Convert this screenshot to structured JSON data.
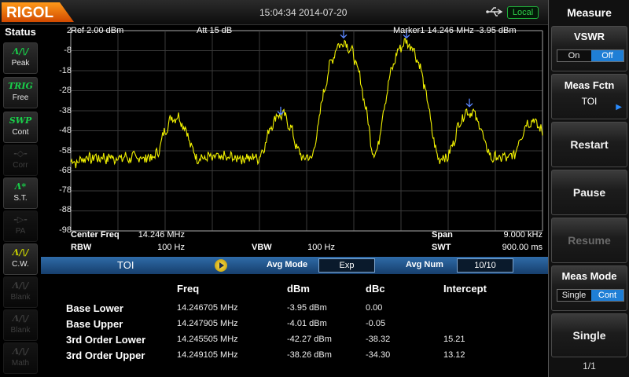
{
  "brand": "RIGOL",
  "datetime": "15:04:34 2014-07-20",
  "local_badge": "Local",
  "status": {
    "title": "Status",
    "items": [
      {
        "icon": "Λ/\\/",
        "label": "Peak",
        "state": "active"
      },
      {
        "icon": "TRIG",
        "label": "Free",
        "state": "active"
      },
      {
        "icon": "SWP",
        "label": "Cont",
        "state": "active"
      },
      {
        "icon": "-◇-",
        "label": "Corr",
        "state": "dim"
      },
      {
        "icon": "Λ*",
        "label": "S.T.",
        "state": "active"
      },
      {
        "icon": "-▷-",
        "label": "PA",
        "state": "dim"
      },
      {
        "icon": "Λ/\\/",
        "label": "C.W.",
        "state": "active"
      },
      {
        "icon": "Λ/\\/",
        "label": "Blank",
        "state": "dim"
      },
      {
        "icon": "Λ/\\/",
        "label": "Blank",
        "state": "dim"
      },
      {
        "icon": "Λ/\\/",
        "label": "Math",
        "state": "dim"
      }
    ]
  },
  "plot": {
    "ref_label": "Ref  2.00 dBm",
    "att_label": "Att      15 dB",
    "marker_label": "Marker1   14.246 MHz   -3.95 dBm",
    "y_ticks": [
      "2",
      "-8",
      "-18",
      "-28",
      "-38",
      "-48",
      "-58",
      "-68",
      "-78",
      "-88",
      "-98"
    ],
    "center_freq_label": "Center Freq",
    "center_freq_value": "14.246 MHz",
    "span_label": "Span",
    "span_value": "9.000 kHz",
    "rbw_label": "RBW",
    "rbw_value": "100 Hz",
    "vbw_label": "VBW",
    "vbw_value": "100 Hz",
    "swt_label": "SWT",
    "swt_value": "900.00 ms",
    "trace_color": "#f2f200",
    "marker_color": "#5b86ff",
    "grid_color": "#3a3a3a"
  },
  "chart_data": {
    "type": "line",
    "x_unit": "MHz",
    "y_unit": "dBm",
    "xlim": [
      14.2415,
      14.2505
    ],
    "ylim": [
      -98,
      2
    ],
    "series": [
      {
        "x": [
          14.2415,
          14.2425,
          14.2435,
          14.2445,
          14.2455,
          14.2467,
          14.2479,
          14.2491,
          14.2503,
          14.2505
        ],
        "y": [
          -64,
          -60,
          -41,
          -59,
          -40,
          -3.95,
          -4.01,
          -38.3,
          -43,
          -62
        ]
      }
    ],
    "markers": [
      {
        "x": 14.246705,
        "y": -3.95
      },
      {
        "x": 14.247905,
        "y": -4.01
      },
      {
        "x": 14.245505,
        "y": -42.27
      },
      {
        "x": 14.249105,
        "y": -38.26
      }
    ]
  },
  "toi": {
    "title": "TOI",
    "avg_mode_label": "Avg Mode",
    "avg_mode_value": "Exp",
    "avg_num_label": "Avg Num",
    "avg_num_value": "10/10",
    "headers": [
      "Freq",
      "dBm",
      "dBc",
      "Intercept"
    ],
    "rows": [
      {
        "label": "Base Lower",
        "freq": "14.246705 MHz",
        "dbm": "-3.95 dBm",
        "dbc": "0.00",
        "intercept": ""
      },
      {
        "label": "Base Upper",
        "freq": "14.247905 MHz",
        "dbm": "-4.01 dBm",
        "dbc": "-0.05",
        "intercept": ""
      },
      {
        "label": "3rd Order Lower",
        "freq": "14.245505 MHz",
        "dbm": "-42.27 dBm",
        "dbc": "-38.32",
        "intercept": "15.21"
      },
      {
        "label": "3rd Order Upper",
        "freq": "14.249105 MHz",
        "dbm": "-38.26 dBm",
        "dbc": "-34.30",
        "intercept": "13.12"
      }
    ]
  },
  "menu": {
    "title": "Measure",
    "vswr_label": "VSWR",
    "vswr_on": "On",
    "vswr_off": "Off",
    "meas_fctn_label": "Meas Fctn",
    "meas_fctn_value": "TOI",
    "restart_label": "Restart",
    "pause_label": "Pause",
    "resume_label": "Resume",
    "meas_mode_label": "Meas Mode",
    "meas_mode_single": "Single",
    "meas_mode_cont": "Cont",
    "single_label": "Single",
    "page": "1/1"
  }
}
